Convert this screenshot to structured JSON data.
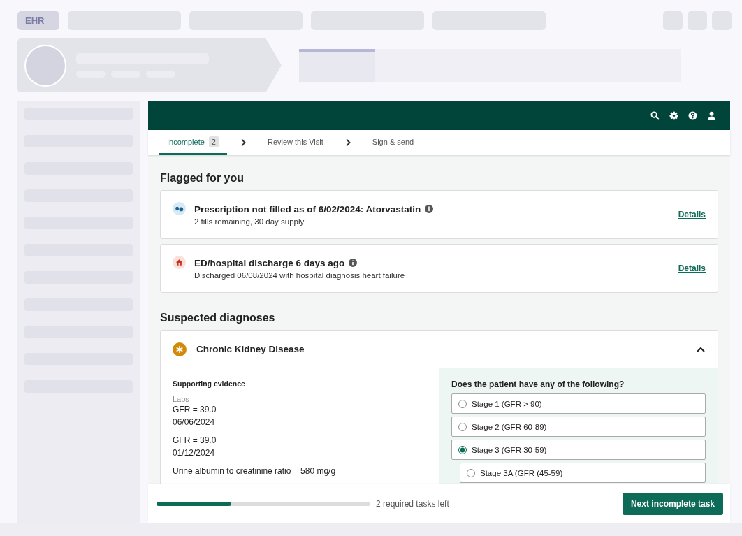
{
  "logo": "EHR",
  "tabs": [
    {
      "label": "Incomplete",
      "count": "2",
      "selected": true
    },
    {
      "label": "Review this Visit",
      "selected": false
    },
    {
      "label": "Sign & send",
      "selected": false
    }
  ],
  "flagged": {
    "title": "Flagged for you",
    "items": [
      {
        "kind": "prescription",
        "title": "Prescription not filled as of 6/02/2024: Atorvastatin",
        "subtitle": "2 fills remaining, 30 day supply",
        "link": "Details"
      },
      {
        "kind": "discharge",
        "title": "ED/hospital discharge 6 days ago",
        "subtitle": "Discharged 06/08/2024 with hospital diagnosis heart failure",
        "link": "Details"
      }
    ]
  },
  "diagnoses": {
    "title": "Suspected diagnoses",
    "items": [
      {
        "name": "Chronic Kidney Disease",
        "expanded": true,
        "evidence": {
          "title": "Supporting evidence",
          "category": "Labs",
          "entries": [
            {
              "lines": [
                "GFR = 39.0",
                "06/06/2024"
              ]
            },
            {
              "lines": [
                "GFR = 39.0",
                "01/12/2024"
              ]
            },
            {
              "lines": [
                "Urine albumin to creatinine ratio = 580 mg/g"
              ]
            }
          ]
        },
        "question": "Does the patient have any of the following?",
        "options": [
          {
            "label": "Stage 1 (GFR > 90)",
            "selected": false
          },
          {
            "label": "Stage 2 (GFR 60-89)",
            "selected": false
          },
          {
            "label": "Stage 3 (GFR 30-59)",
            "selected": true,
            "children": [
              {
                "label": "Stage 3A (GFR (45-59)",
                "selected": false
              }
            ]
          }
        ]
      }
    ]
  },
  "footer": {
    "level": 0.35,
    "tasks_left": "2 required tasks left",
    "button": "Next incomplete task"
  }
}
